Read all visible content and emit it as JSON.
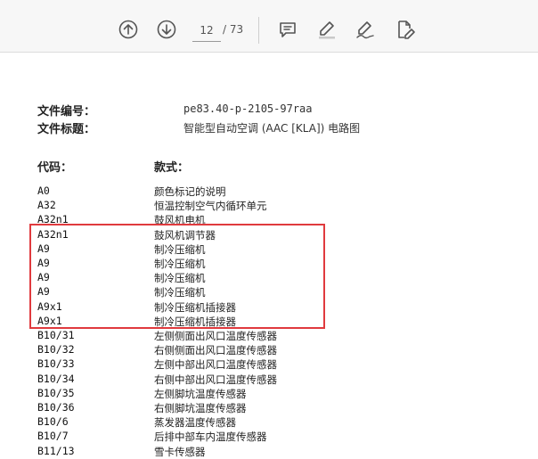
{
  "toolbar": {
    "current_page": "12",
    "total_pages": "/ 73",
    "buttons": [
      "up-arrow-icon",
      "down-arrow-icon",
      "comment-icon",
      "highlight-pen-icon",
      "sign-icon",
      "edit-document-icon"
    ]
  },
  "document": {
    "file_number_label": "文件编号：",
    "file_number_value": "pe83.40-p-2105-97raa",
    "file_title_label": "文件标题：",
    "file_title_value": "智能型自动空调 (AAC [KLA]) 电路图",
    "col_code": "代码：",
    "col_style": "款式：",
    "rows": [
      {
        "code": "A0",
        "desc": "颜色标记的说明"
      },
      {
        "code": "A32",
        "desc": "恒温控制空气内循环单元"
      },
      {
        "code": "A32n1",
        "desc": "鼓风机电机"
      },
      {
        "code": "A32n1",
        "desc": "鼓风机调节器"
      },
      {
        "code": "A9",
        "desc": "制冷压缩机"
      },
      {
        "code": "A9",
        "desc": "制冷压缩机"
      },
      {
        "code": "A9",
        "desc": "制冷压缩机"
      },
      {
        "code": "A9",
        "desc": "制冷压缩机"
      },
      {
        "code": "A9x1",
        "desc": "制冷压缩机插接器"
      },
      {
        "code": "A9x1",
        "desc": "制冷压缩机插接器"
      },
      {
        "code": "B10/31",
        "desc": "左侧侧面出风口温度传感器"
      },
      {
        "code": "B10/32",
        "desc": "右侧侧面出风口温度传感器"
      },
      {
        "code": "B10/33",
        "desc": "左侧中部出风口温度传感器"
      },
      {
        "code": "B10/34",
        "desc": "右侧中部出风口温度传感器"
      },
      {
        "code": "B10/35",
        "desc": "左侧脚坑温度传感器"
      },
      {
        "code": "B10/36",
        "desc": "右侧脚坑温度传感器"
      },
      {
        "code": "B10/6",
        "desc": "蒸发器温度传感器"
      },
      {
        "code": "B10/7",
        "desc": "后排中部车内温度传感器"
      },
      {
        "code": "B11/13",
        "desc": "雪卡传感器"
      }
    ]
  },
  "colors": {
    "highlight": "#e03a3e",
    "toolbar_bg": "#f7f7f7"
  }
}
